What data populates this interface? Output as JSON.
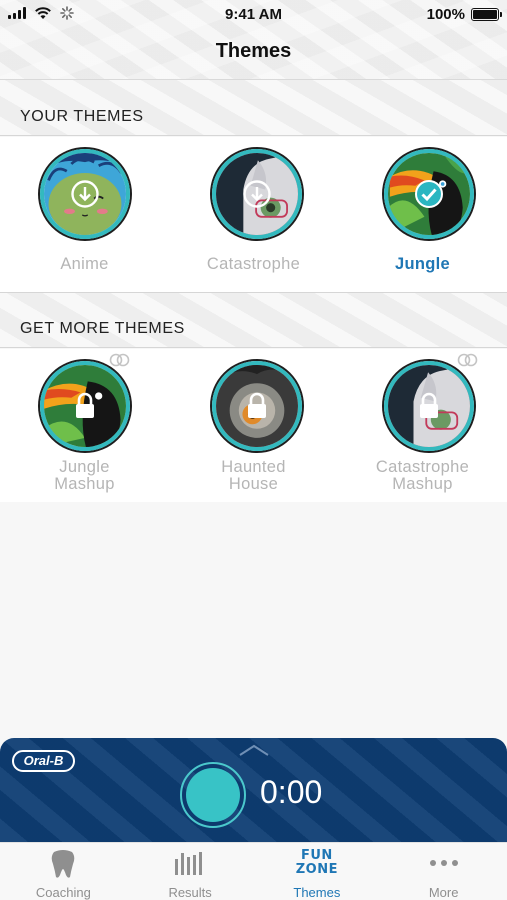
{
  "status_bar": {
    "time": "9:41 AM",
    "battery": "100%"
  },
  "header": {
    "title": "Themes"
  },
  "sections": {
    "your_themes": {
      "title": "YOUR THEMES",
      "items": [
        {
          "label": "Anime",
          "state": "download",
          "icon": "download-icon"
        },
        {
          "label": "Catastrophe",
          "state": "download",
          "icon": "download-icon"
        },
        {
          "label": "Jungle",
          "state": "selected",
          "icon": "checkmark-icon"
        }
      ]
    },
    "more_themes": {
      "title": "GET MORE THEMES",
      "items": [
        {
          "label": "Jungle Mashup",
          "state": "locked",
          "icon": "lock-icon",
          "coins": true
        },
        {
          "label": "Haunted House",
          "state": "locked",
          "icon": "lock-icon",
          "coins": false
        },
        {
          "label": "Catastrophe Mashup",
          "state": "locked",
          "icon": "lock-icon",
          "coins": true
        }
      ]
    }
  },
  "timer": {
    "brand": "Oral-B",
    "time": "0:00"
  },
  "tabs": [
    {
      "label": "Coaching",
      "icon": "tooth-icon"
    },
    {
      "label": "Results",
      "icon": "bar-chart-icon"
    },
    {
      "label": "Themes",
      "icon": "fun-zone-icon",
      "icon_text_line1": "FUN",
      "icon_text_line2": "ZONE",
      "active": true
    },
    {
      "label": "More",
      "icon": "more-dots-icon"
    }
  ],
  "colors": {
    "accent": "#1f77b5",
    "ring": "#33b9be",
    "timer_bg": "#0e3d73",
    "disabled_text": "#b5b5b5"
  }
}
